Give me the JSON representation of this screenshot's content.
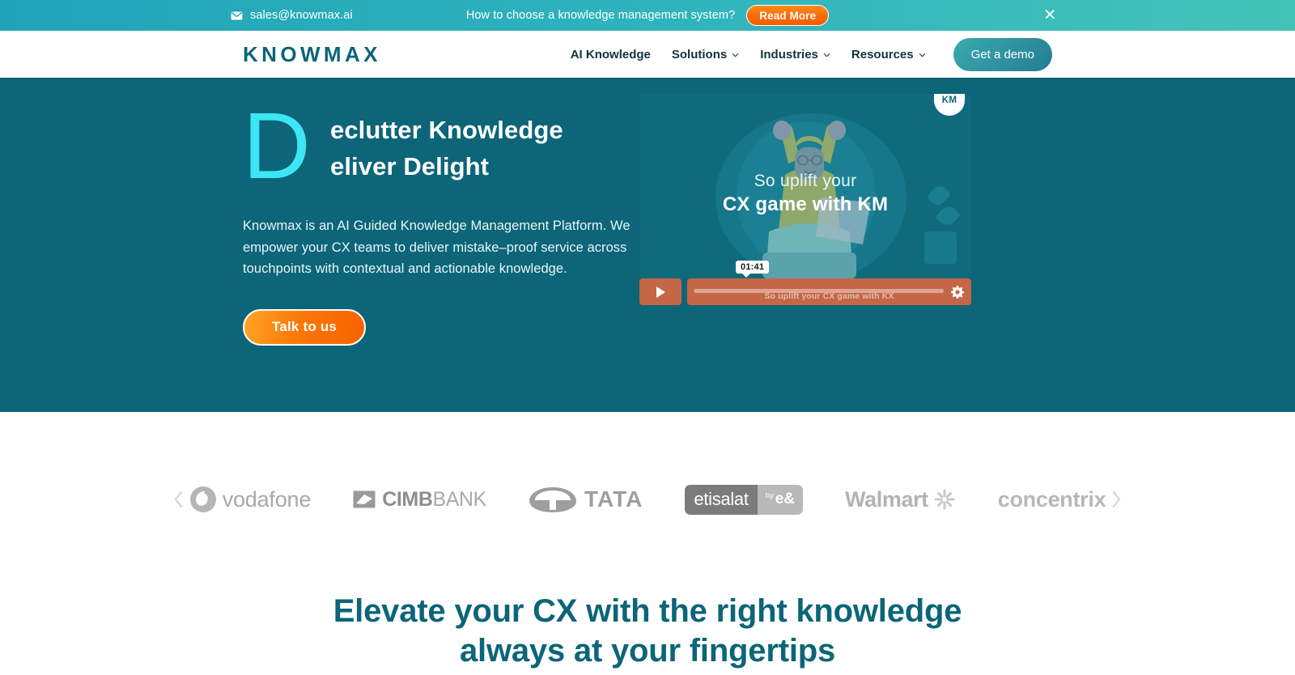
{
  "announcement": {
    "email": "sales@knowmax.ai",
    "mail_icon": "envelope-icon",
    "message": "How to choose a knowledge management system?",
    "cta_label": "Read More",
    "close_icon": "close-icon",
    "gradient_from": "#22a3b9",
    "gradient_to": "#44c3b9"
  },
  "header": {
    "logo": "KNOWMAX",
    "nav": [
      {
        "label": "AI Knowledge",
        "has_caret": false
      },
      {
        "label": "Solutions",
        "has_caret": true
      },
      {
        "label": "Industries",
        "has_caret": true
      },
      {
        "label": "Resources",
        "has_caret": true
      }
    ],
    "demo_label": "Get a demo"
  },
  "hero": {
    "background": "#0c6578",
    "dropcap": "D",
    "heading_line1": "eclutter Knowledge",
    "heading_line2": "eliver Delight",
    "dropcap_color": "#3ce6f5",
    "paragraph": "Knowmax is an AI Guided Knowledge Management Platform. We empower your CX teams to deliver mistake–proof service across touchpoints with contextual and actionable knowledge.",
    "cta_label": "Talk to us",
    "video": {
      "badge": "KM",
      "caption_line1": "So uplift your",
      "caption_line2": "CX game with KM",
      "subtitle": "So uplift your CX game with KX",
      "timestamp": "01:41",
      "play_icon": "play-icon",
      "settings_icon": "gear-icon",
      "progress_percent": 0
    }
  },
  "logo_carousel": {
    "prev_icon": "chevron-left-icon",
    "next_icon": "chevron-right-icon",
    "logos": [
      {
        "name": "vodafone",
        "label": "vodafone"
      },
      {
        "name": "cimb-bank",
        "label_bold": "CIMB",
        "label_light": "BANK"
      },
      {
        "name": "tata",
        "label": "TATA"
      },
      {
        "name": "etisalat",
        "label": "etisalat",
        "sub_by": "by",
        "sub_label": "e&"
      },
      {
        "name": "walmart",
        "label": "Walmart"
      },
      {
        "name": "concentrix",
        "label": "concentrix"
      }
    ]
  },
  "section": {
    "heading_line1": "Elevate your CX with the right knowledge",
    "heading_line2": "always at your fingertips",
    "heading_color": "#0c6578"
  }
}
